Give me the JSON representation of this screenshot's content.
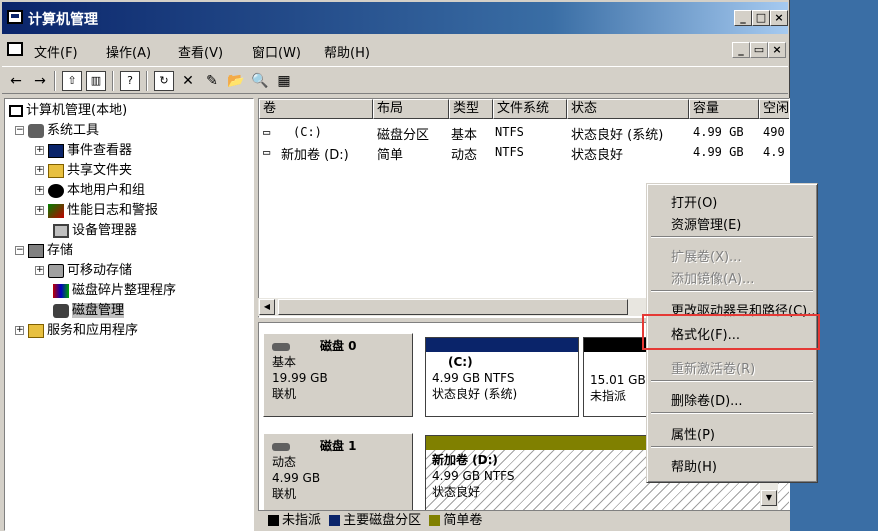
{
  "window": {
    "title": "计算机管理"
  },
  "menubar": {
    "items": [
      "文件(F)",
      "操作(A)",
      "查看(V)",
      "窗口(W)",
      "帮助(H)"
    ]
  },
  "tree": {
    "root": "计算机管理(本地)",
    "system_tools": "系统工具",
    "event_viewer": "事件查看器",
    "shared_folders": "共享文件夹",
    "local_users": "本地用户和组",
    "perf_logs": "性能日志和警报",
    "device_manager": "设备管理器",
    "storage": "存储",
    "removable": "可移动存储",
    "defrag": "磁盘碎片整理程序",
    "disk_mgmt": "磁盘管理",
    "services": "服务和应用程序"
  },
  "volume_list": {
    "columns": [
      "卷",
      "布局",
      "类型",
      "文件系统",
      "状态",
      "容量",
      "空闲"
    ],
    "rows": [
      {
        "volume": "(C:)",
        "layout": "磁盘分区",
        "type": "基本",
        "fs": "NTFS",
        "status": "状态良好 (系统)",
        "capacity": "4.99 GB",
        "free": "490"
      },
      {
        "volume": "新加卷 (D:)",
        "layout": "简单",
        "type": "动态",
        "fs": "NTFS",
        "status": "状态良好",
        "capacity": "4.99 GB",
        "free": "4.9"
      }
    ]
  },
  "disks": [
    {
      "name": "磁盘 0",
      "type": "基本",
      "size": "19.99 GB",
      "state": "联机",
      "parts": [
        {
          "name": "(C:)",
          "detail": "4.99 GB NTFS",
          "status": "状态良好 (系统)"
        },
        {
          "detail": "15.01 GB",
          "status": "未指派"
        }
      ]
    },
    {
      "name": "磁盘 1",
      "type": "动态",
      "size": "4.99 GB",
      "state": "联机",
      "parts": [
        {
          "name": "新加卷  (D:)",
          "detail": "4.99 GB NTFS",
          "status": "状态良好"
        }
      ]
    }
  ],
  "legend": [
    {
      "label": "未指派",
      "color": "#000000"
    },
    {
      "label": "主要磁盘分区",
      "color": "#0a246a"
    },
    {
      "label": "简单卷",
      "color": "#808000"
    }
  ],
  "context_menu": {
    "open": "打开(O)",
    "explore": "资源管理(E)",
    "extend": "扩展卷(X)...",
    "add_mirror": "添加镜像(A)...",
    "change_letter": "更改驱动器号和路径(C)...",
    "format": "格式化(F)...",
    "reactivate": "重新激活卷(R)",
    "delete": "删除卷(D)...",
    "properties": "属性(P)",
    "help": "帮助(H)"
  },
  "colors": {
    "highlight": "#e53935",
    "primary": "#0a246a",
    "simple": "#808000",
    "unallocated": "#000000"
  }
}
